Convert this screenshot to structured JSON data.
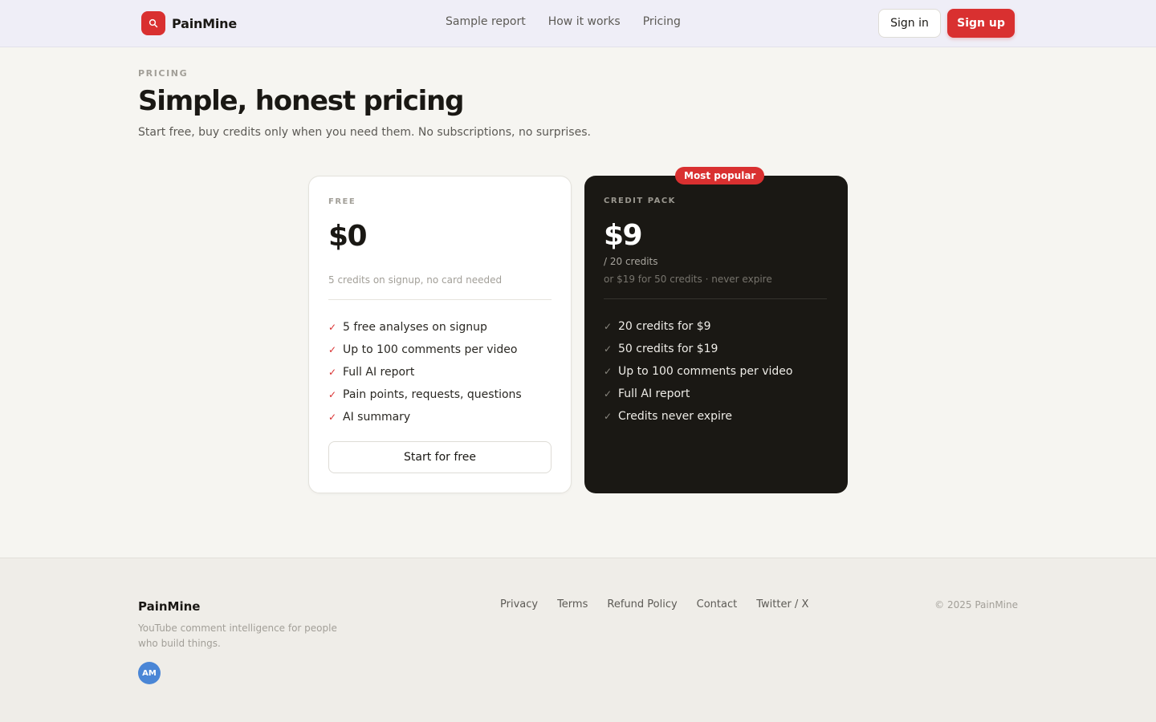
{
  "header": {
    "logo_text": "PainMine",
    "logo_icon": "search-icon",
    "nav": [
      {
        "label": "Sample report"
      },
      {
        "label": "How it works"
      },
      {
        "label": "Pricing"
      }
    ],
    "sign_in_label": "Sign in",
    "sign_up_label": "Sign up"
  },
  "hero": {
    "eyebrow": "PRICING",
    "title": "Simple, honest pricing",
    "subtitle": "Start free, buy credits only when you need them. No subscriptions, no surprises."
  },
  "plans": [
    {
      "label": "FREE",
      "price": "$0",
      "note": "5 credits on signup, no card needed",
      "features": [
        "5 free analyses on signup",
        "Up to 100 comments per video",
        "Full AI report",
        "Pain points, requests, questions",
        "AI summary"
      ],
      "cta_label": "Start for free"
    },
    {
      "label": "CREDIT PACK",
      "badge": "Most popular",
      "price": "$9",
      "unit": "/ 20 credits",
      "note": "or $19 for 50 credits · never expire",
      "features": [
        "20 credits for $9",
        "50 credits for $19",
        "Up to 100 comments per video",
        "Full AI report",
        "Credits never expire"
      ]
    }
  ],
  "check_glyph": "✓",
  "footer": {
    "brand": "PainMine",
    "tagline": "YouTube comment intelligence for people who build things.",
    "avatar_initials": "AM",
    "links": [
      {
        "label": "Privacy"
      },
      {
        "label": "Terms"
      },
      {
        "label": "Refund Policy"
      },
      {
        "label": "Contact"
      },
      {
        "label": "Twitter / X"
      }
    ],
    "copyright": "© 2025 PainMine"
  },
  "colors": {
    "accent": "#d93030",
    "dark_card": "#1a1814",
    "page_bg": "#f6f5f1",
    "header_bg": "#efeef7",
    "avatar_bg": "#4a86d6"
  }
}
